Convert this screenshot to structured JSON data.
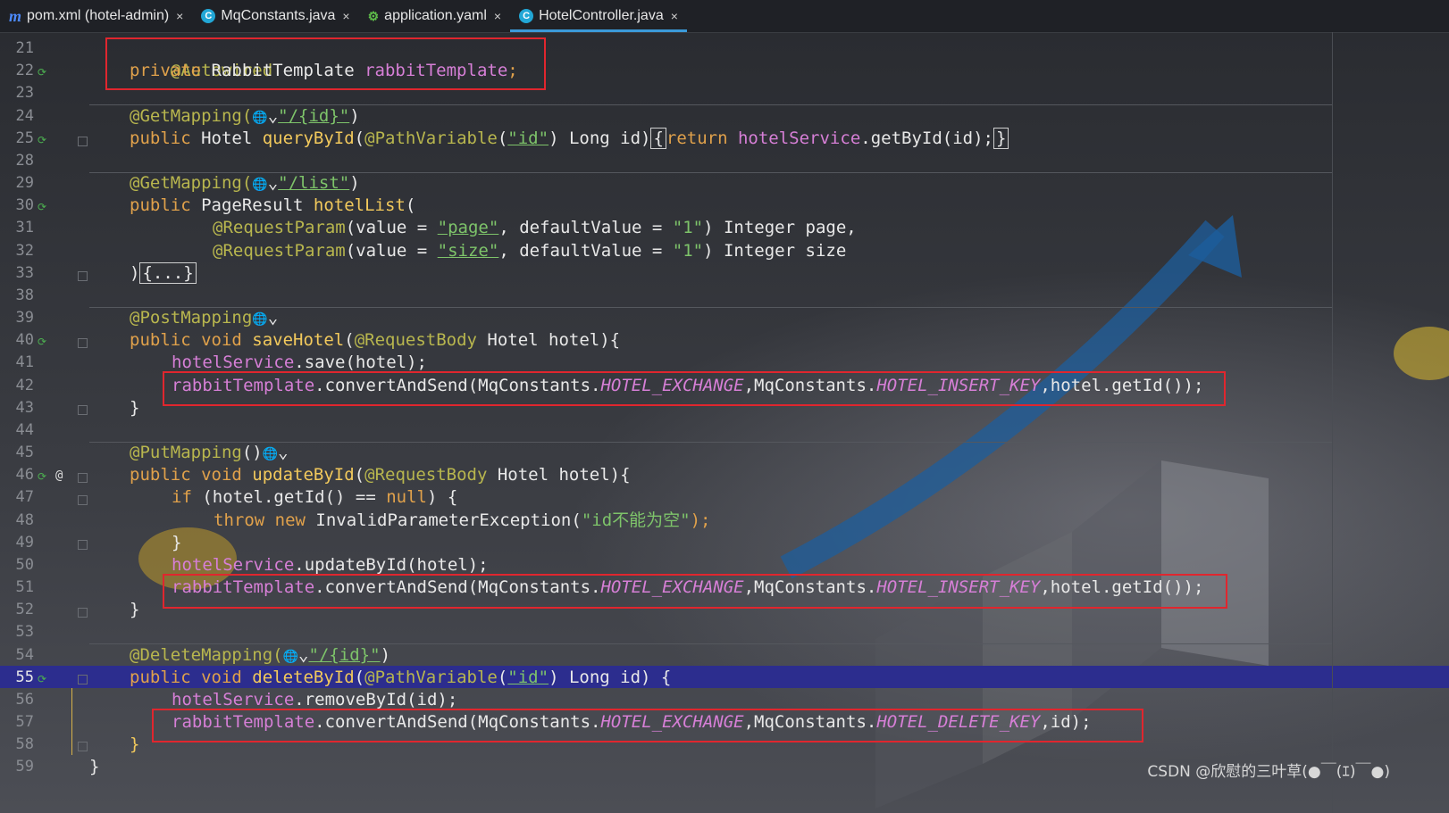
{
  "tabs": [
    {
      "icon": "maven-icon",
      "icon_glyph": "m",
      "label": "pom.xml (hotel-admin)",
      "close": "×",
      "active": false
    },
    {
      "icon": "class-icon",
      "icon_glyph": "C",
      "label": "MqConstants.java",
      "close": "×",
      "active": false
    },
    {
      "icon": "yaml-icon",
      "icon_glyph": "⚙",
      "label": "application.yaml",
      "close": "×",
      "active": false
    },
    {
      "icon": "class-icon",
      "icon_glyph": "C",
      "label": "HotelController.java",
      "close": "×",
      "active": true
    }
  ],
  "line_numbers": [
    "21",
    "22",
    "23",
    "24",
    "25",
    "28",
    "29",
    "30",
    "31",
    "32",
    "33",
    "38",
    "39",
    "40",
    "41",
    "42",
    "43",
    "44",
    "45",
    "46",
    "47",
    "48",
    "49",
    "50",
    "51",
    "52",
    "53",
    "54",
    "55",
    "56",
    "57",
    "58",
    "59"
  ],
  "current_line": "55",
  "code": {
    "l21": {
      "ann": "@Autowired"
    },
    "l22": {
      "kw": "private",
      "type": " RabbitTemplate ",
      "field": "rabbitTemplate",
      "end": ";"
    },
    "l24": {
      "ann": "@GetMapping(",
      "globe": "🌐",
      "chev": "⌄",
      "str": "\"/{id}\"",
      "end": ")"
    },
    "l25": {
      "kw": "public",
      "type": " Hotel ",
      "fn": "queryById",
      "p1": "(",
      "ann": "@PathVariable",
      "p2": "(",
      "str": "\"id\"",
      "p3": ") Long id)",
      "ob": "{",
      "kw2": "return ",
      "field": "hotelService",
      "call": ".getById(id);",
      "cb": "}"
    },
    "l29": {
      "ann": "@GetMapping(",
      "str": "\"/list\"",
      "end": ")"
    },
    "l30": {
      "kw": "public",
      "type": " PageResult ",
      "fn": "hotelList",
      "end": "("
    },
    "l31": {
      "ann": "@RequestParam",
      "a": "(value = ",
      "str1": "\"page\"",
      "b": ", defaultValue = ",
      "str2": "\"1\"",
      "c": ") Integer page,"
    },
    "l32": {
      "ann": "@RequestParam",
      "a": "(value = ",
      "str1": "\"size\"",
      "b": ", defaultValue = ",
      "str2": "\"1\"",
      "c": ") Integer size"
    },
    "l33": {
      "a": ")",
      "fold": "{...}"
    },
    "l39": {
      "ann": "@PostMapping"
    },
    "l40": {
      "kw": "public void ",
      "fn": "saveHotel",
      "p": "(",
      "ann": "@RequestBody",
      "rest": " Hotel hotel){"
    },
    "l41": {
      "field": "hotelService",
      "rest": ".save(hotel);"
    },
    "l42": {
      "field": "rabbitTemplate",
      "a": ".convertAndSend(MqConstants.",
      "c1": "HOTEL_EXCHANGE",
      "b": ",MqConstants.",
      "c2": "HOTEL_INSERT_KEY",
      "c": ",hotel.getId());"
    },
    "l43": {
      "a": "}"
    },
    "l45": {
      "ann": "@PutMapping",
      "rest": "()"
    },
    "l46": {
      "kw": "public void ",
      "fn": "updateById",
      "p": "(",
      "ann": "@RequestBody",
      "rest": " Hotel hotel){"
    },
    "l47": {
      "kw": "if",
      "a": " (hotel.getId() == ",
      "kw2": "null",
      "b": ") {"
    },
    "l48": {
      "kw": "throw new",
      "a": " InvalidParameterException(",
      "str": "\"id不能为空\"",
      "b": ");"
    },
    "l49": {
      "a": "}"
    },
    "l50": {
      "field": "hotelService",
      "rest": ".updateById(hotel);"
    },
    "l51": {
      "field": "rabbitTemplate",
      "a": ".convertAndSend(MqConstants.",
      "c1": "HOTEL_EXCHANGE",
      "b": ",MqConstants.",
      "c2": "HOTEL_INSERT_KEY",
      "c": ",hotel.getId());"
    },
    "l52": {
      "a": "}"
    },
    "l54": {
      "ann": "@DeleteMapping(",
      "str": "\"/{id}\"",
      "end": ")"
    },
    "l55": {
      "kw": "public void ",
      "fn": "deleteById",
      "p": "(",
      "ann": "@PathVariable",
      "p2": "(",
      "str": "\"id\"",
      "rest": ") Long id) {"
    },
    "l56": {
      "field": "hotelService",
      "rest": ".removeById(id);"
    },
    "l57": {
      "field": "rabbitTemplate",
      "a": ".convertAndSend(MqConstants.",
      "c1": "HOTEL_EXCHANGE",
      "b": ",MqConstants.",
      "c2": "HOTEL_DELETE_KEY",
      "c": ",id);"
    },
    "l58": {
      "a": "}"
    },
    "l59": {
      "a": "}"
    }
  },
  "gutter_at": "@",
  "gutter_run_glyph": "⟳",
  "watermark": "CSDN @欣慰的三叶草(●￣(ｴ)￣●)",
  "colors": {
    "keyword": "#e0a14b",
    "annotation": "#b8b64e",
    "method": "#f2c95c",
    "field": "#d67fd6",
    "string": "#7ec46a",
    "highlight_box": "#e0262e",
    "current_line": "#2c2d8e"
  }
}
